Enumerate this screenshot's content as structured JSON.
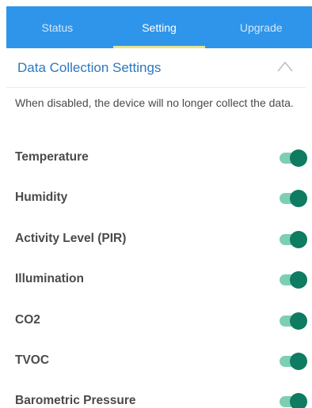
{
  "tabs": [
    {
      "label": "Status",
      "active": false
    },
    {
      "label": "Setting",
      "active": true
    },
    {
      "label": "Upgrade",
      "active": false
    }
  ],
  "section": {
    "title": "Data Collection Settings",
    "collapse_icon": "chevron-up-icon",
    "description": "When disabled, the device will no longer collect the data."
  },
  "settings": [
    {
      "label": "Temperature",
      "enabled": true
    },
    {
      "label": "Humidity",
      "enabled": true
    },
    {
      "label": "Activity Level (PIR)",
      "enabled": true
    },
    {
      "label": "Illumination",
      "enabled": true
    },
    {
      "label": "CO2",
      "enabled": true
    },
    {
      "label": "TVOC",
      "enabled": true
    },
    {
      "label": "Barometric Pressure",
      "enabled": true
    }
  ],
  "colors": {
    "tab_bar": "#2f95ea",
    "tab_indicator": "#e6e38f",
    "section_title": "#2b78c1",
    "toggle_track": "#7dcfb3",
    "toggle_thumb": "#0f7b61"
  }
}
